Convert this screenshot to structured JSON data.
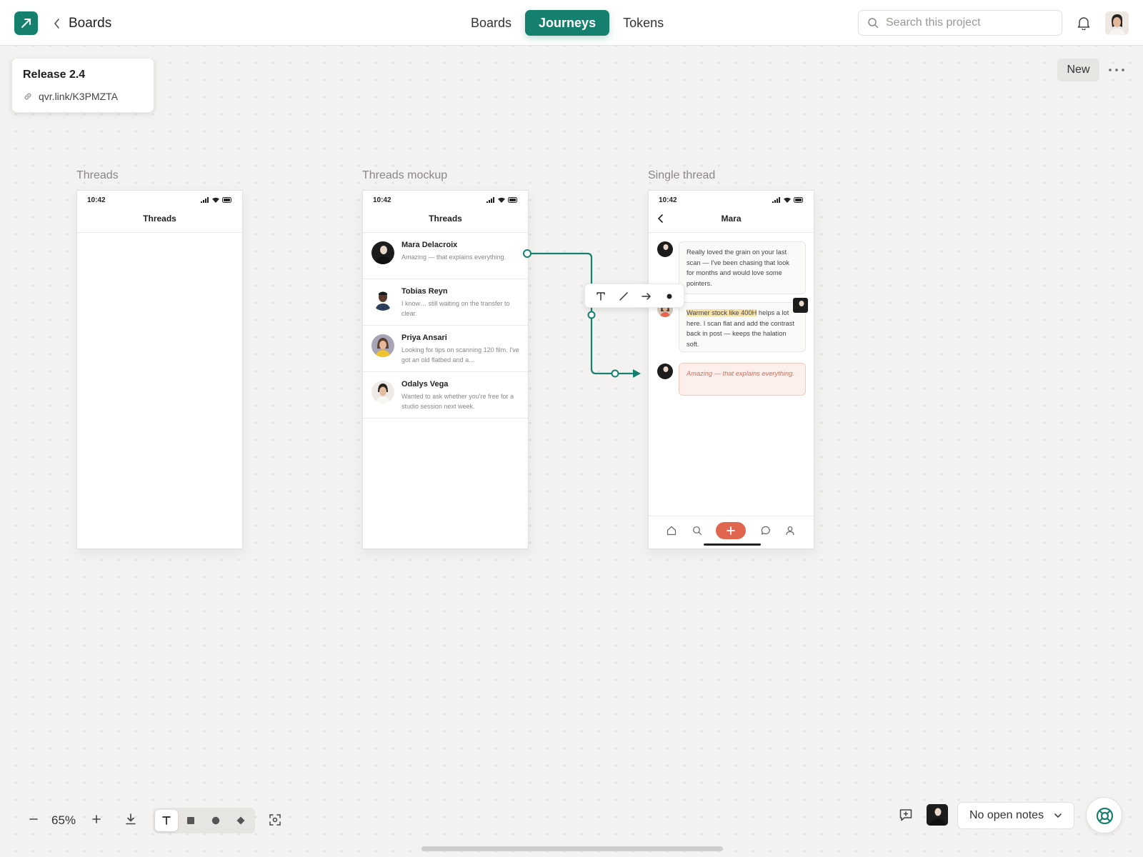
{
  "header": {
    "back_label": "Boards",
    "tabs": [
      {
        "label": "Boards",
        "active": false
      },
      {
        "label": "Journeys",
        "active": true
      },
      {
        "label": "Tokens",
        "active": false
      }
    ],
    "search_placeholder": "Search this project"
  },
  "release": {
    "title": "Release 2.4",
    "link": "qvr.link/K3PMZTA"
  },
  "canvas_actions": {
    "new_label": "New"
  },
  "frames": [
    {
      "label": "Threads",
      "status_time": "10:42",
      "screen_title": "Threads"
    },
    {
      "label": "Threads mockup",
      "status_time": "10:42",
      "screen_title": "Threads",
      "threads": [
        {
          "name": "Mara Delacroix",
          "preview": "Amazing — that explains everything."
        },
        {
          "name": "Tobias Reyn",
          "preview": "I know… still waiting on the transfer to clear."
        },
        {
          "name": "Priya Ansari",
          "preview": "Looking for tips on scanning 120 film. I've got an old flatbed and a…"
        },
        {
          "name": "Odalys Vega",
          "preview": "Wanted to ask whether you're free for a studio session next week."
        }
      ]
    },
    {
      "label": "Single thread",
      "status_time": "10:42",
      "screen_title": "Mara",
      "messages": [
        {
          "text": "Really loved the grain on your last scan — I've been chasing that look for months and would love some pointers."
        },
        {
          "highlight": "Warmer stock like 400H",
          "text": " helps a lot here. I scan flat and add the contrast back in post — keeps the halation soft."
        },
        {
          "text": "Amazing — that explains everything."
        }
      ]
    }
  ],
  "toolbar": {
    "zoom": "65%"
  },
  "notes": {
    "selected": "No open notes"
  },
  "colors": {
    "accent": "#14806d",
    "coral": "#e06650",
    "canvas": "#f3f2f0"
  },
  "icons": [
    "logo-icon",
    "chevron-left-icon",
    "search-icon",
    "bell-icon",
    "link-icon",
    "more-icon",
    "signal-icon",
    "wifi-icon",
    "battery-icon",
    "text-tool-icon",
    "line-tool-icon",
    "arrow-tool-icon",
    "dot-tool-icon",
    "home-icon",
    "plus-icon",
    "chat-icon",
    "person-icon",
    "minus-icon",
    "download-icon",
    "square-icon",
    "circle-icon",
    "diamond-icon",
    "fit-icon",
    "comment-icon",
    "chevron-down-icon",
    "lifebuoy-icon"
  ]
}
